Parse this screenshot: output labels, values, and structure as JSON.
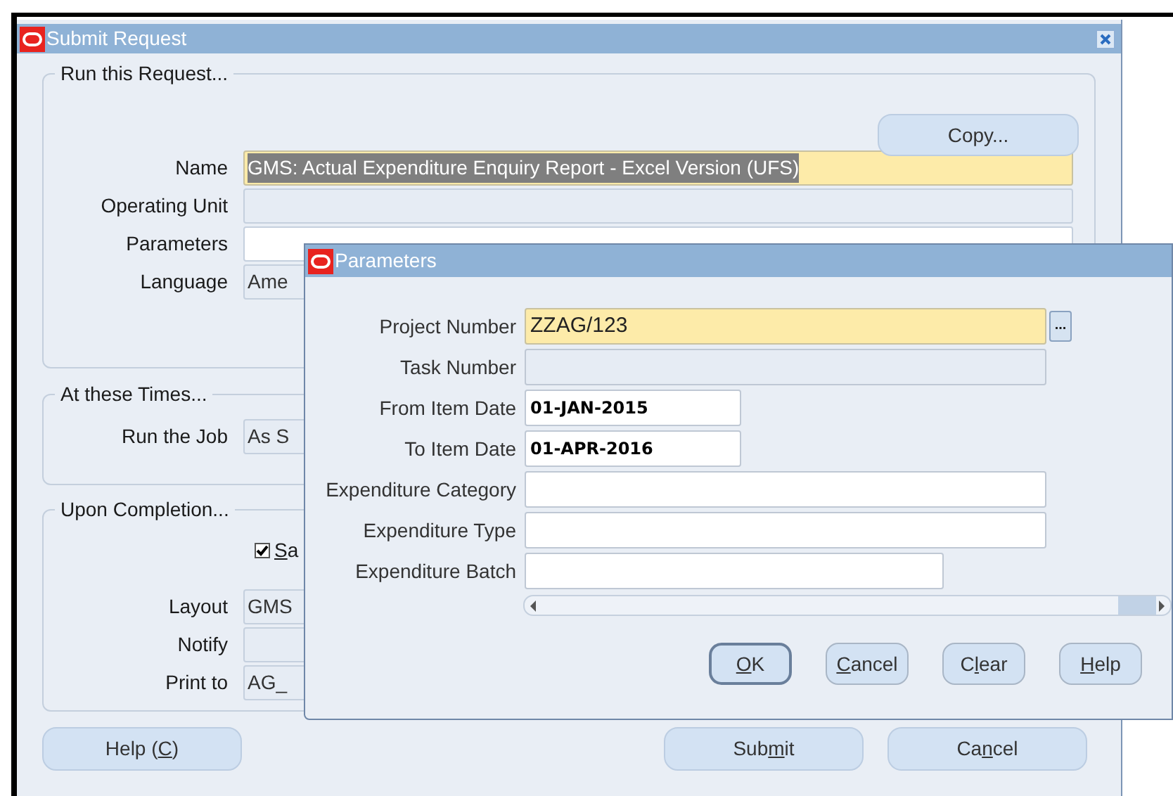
{
  "window": {
    "title": "Submit Request"
  },
  "run_request": {
    "legend": "Run this Request...",
    "copy_button": "Copy...",
    "fields": [
      {
        "label": "Name",
        "value": "GMS: Actual Expenditure Enquiry Report - Excel Version (UFS)",
        "kind": "focused"
      },
      {
        "label": "Operating Unit",
        "kind": "readonly"
      },
      {
        "label": "Parameters",
        "kind": "editable"
      },
      {
        "label": "Language",
        "value": "Ame",
        "kind": "readonly"
      }
    ]
  },
  "schedule": {
    "legend": "At these Times...",
    "fields": [
      {
        "label": "Run the Job",
        "value": "As S",
        "kind": "readonly"
      }
    ]
  },
  "completion": {
    "legend": "Upon Completion...",
    "save_option": {
      "key": "S",
      "post": "a",
      "checked": true
    },
    "fields": [
      {
        "label": "Layout",
        "value": "GMS",
        "kind": "readonly"
      },
      {
        "label": "Notify",
        "kind": "readonly"
      },
      {
        "label": "Print to",
        "value": "AG_",
        "kind": "readonly"
      }
    ]
  },
  "footer": {
    "left": [
      {
        "pre": "Help (",
        "key": "C",
        "post": ")"
      }
    ],
    "right": [
      {
        "pre": "Sub",
        "key": "m",
        "post": "it"
      },
      {
        "pre": "Ca",
        "key": "n",
        "post": "cel"
      }
    ]
  },
  "dialog": {
    "title": "Parameters",
    "fields": [
      {
        "label": "Project Number",
        "value": "ZZAG/123",
        "kind": "focused",
        "lov_button": "..."
      },
      {
        "label": "Task Number",
        "kind": "disabled"
      },
      {
        "label": "From Item Date",
        "value": "01-JAN-2015",
        "kind": "date"
      },
      {
        "label": "To Item Date",
        "value": "01-APR-2016",
        "kind": "date"
      },
      {
        "label": "Expenditure Category",
        "kind": "text"
      },
      {
        "label": "Expenditure Type",
        "kind": "text"
      },
      {
        "label": "Expenditure Batch",
        "kind": "short"
      }
    ],
    "buttons": [
      {
        "key": "O",
        "post": "K",
        "default": true
      },
      {
        "key": "C",
        "post": "ancel",
        "default": false
      },
      {
        "pre": "C",
        "key": "l",
        "post": "ear",
        "default": false
      },
      {
        "key": "H",
        "post": "elp",
        "default": false
      }
    ]
  }
}
